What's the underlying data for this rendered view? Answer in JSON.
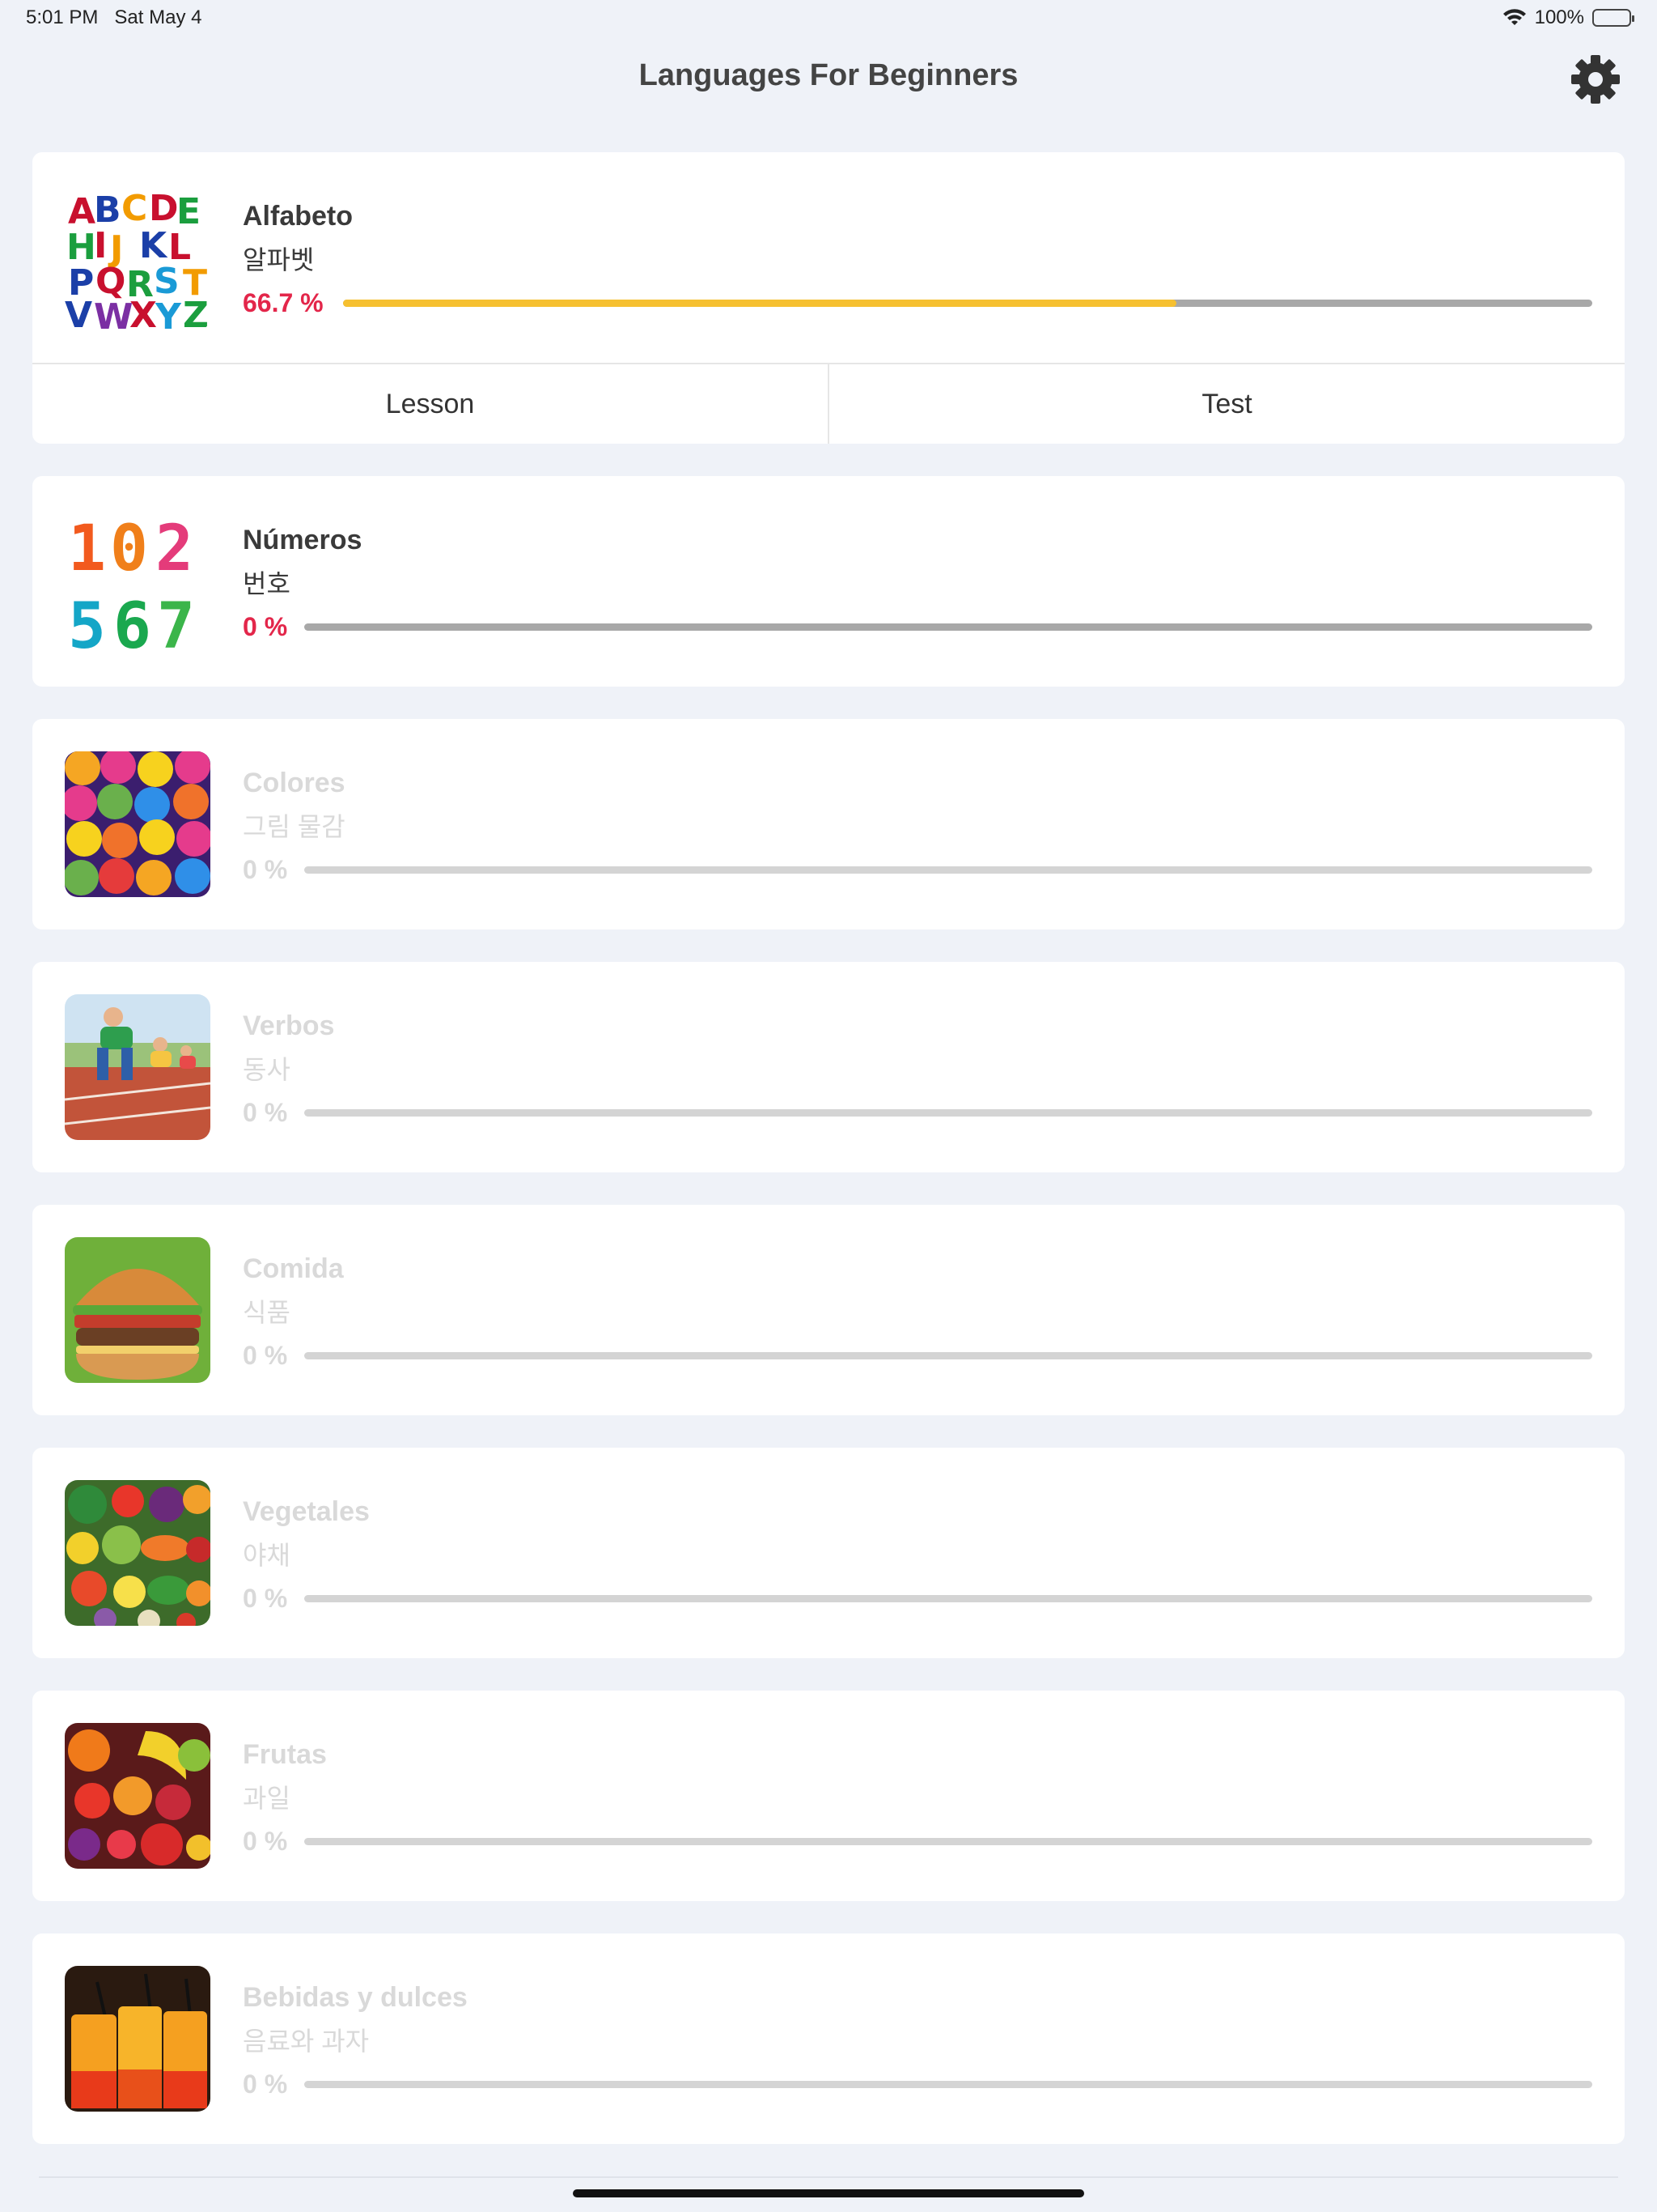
{
  "status": {
    "time": "5:01 PM",
    "date": "Sat May 4",
    "battery": "100%"
  },
  "nav": {
    "title": "Languages For Beginners",
    "settings_icon": "gear-icon"
  },
  "colors": {
    "accent_pct": "#e3264a",
    "progress": "#f6c030",
    "track": "#a8a8a8",
    "track_locked": "#d4d4d4"
  },
  "categories": [
    {
      "title": "Alfabeto",
      "subtitle": "알파벳",
      "percent_label": "66.7 %",
      "progress": 0.667,
      "locked": false,
      "actions": {
        "lesson": "Lesson",
        "test": "Test"
      },
      "image": "alphabet-letters"
    },
    {
      "title": "Números",
      "subtitle": "번호",
      "percent_label": "0 %",
      "progress": 0,
      "locked": false,
      "image": "numbers"
    },
    {
      "title": "Colores",
      "subtitle": "그림 물감",
      "percent_label": "0 %",
      "progress": 0,
      "locked": true,
      "image": "candies"
    },
    {
      "title": "Verbos",
      "subtitle": "동사",
      "percent_label": "0 %",
      "progress": 0,
      "locked": true,
      "image": "children-running"
    },
    {
      "title": "Comida",
      "subtitle": "식품",
      "percent_label": "0 %",
      "progress": 0,
      "locked": true,
      "image": "burger"
    },
    {
      "title": "Vegetales",
      "subtitle": "야채",
      "percent_label": "0 %",
      "progress": 0,
      "locked": true,
      "image": "vegetables"
    },
    {
      "title": "Frutas",
      "subtitle": "과일",
      "percent_label": "0 %",
      "progress": 0,
      "locked": true,
      "image": "fruits"
    },
    {
      "title": "Bebidas y dulces",
      "subtitle": "음료와 과자",
      "percent_label": "0 %",
      "progress": 0,
      "locked": true,
      "image": "drinks"
    }
  ]
}
